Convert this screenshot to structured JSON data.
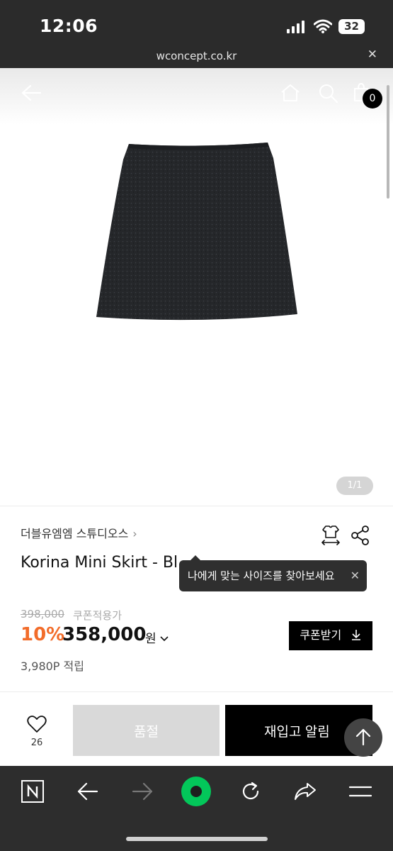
{
  "status_bar": {
    "time": "12:06",
    "battery": "32"
  },
  "browser": {
    "url": "wconcept.co.kr",
    "close_symbol": "✕"
  },
  "header": {
    "cart_count": "0"
  },
  "gallery": {
    "pager": "1/1",
    "product_color": "#25272a"
  },
  "product": {
    "brand": "더블유엠엠 스튜디오스",
    "brand_chevron": "›",
    "title": "Korina Mini Skirt - Bl",
    "size_tooltip": "나에게 맞는 사이즈를 찾아보세요",
    "original_price": "398,000",
    "coupon_note": "쿠폰적용가",
    "discount": "10%",
    "price": "358,000",
    "currency": "원",
    "coupon_button": "쿠폰받기",
    "points": "3,980P 적립"
  },
  "action_bar": {
    "like_count": "26",
    "soldout_label": "품절",
    "restock_label": "재입고 알림"
  },
  "colors": {
    "accent": "#f26c2a",
    "naver_green": "#03c75a",
    "toolbar_bg": "#2d2d2d"
  },
  "icons": [
    "back-icon",
    "home-icon",
    "search-icon",
    "cart-icon",
    "size-guide-icon",
    "share-icon",
    "heart-icon",
    "download-icon",
    "arrow-up-icon",
    "naver-icon",
    "browser-back-icon",
    "browser-forward-icon",
    "green-dot-icon",
    "reload-icon",
    "browser-share-icon",
    "menu-icon"
  ]
}
